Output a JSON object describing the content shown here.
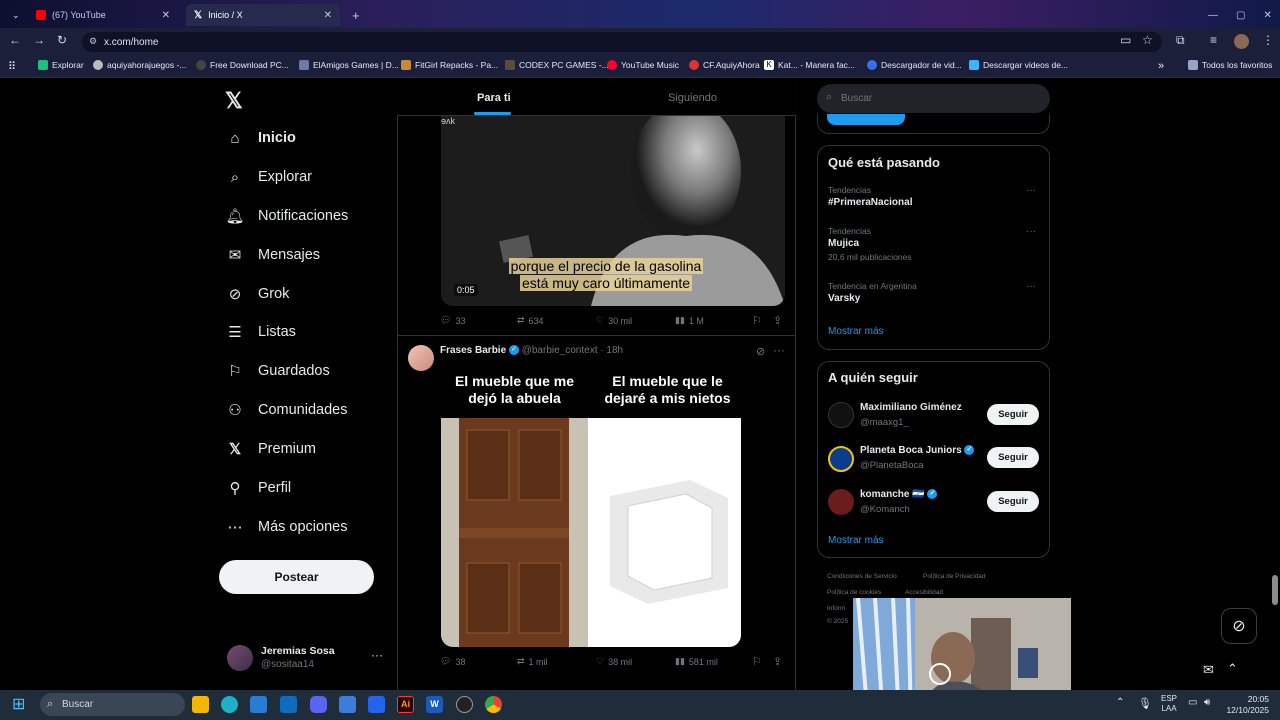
{
  "browser": {
    "tabs": [
      {
        "title": "(67) YouTube",
        "active": false,
        "color": "#ff0000"
      },
      {
        "title": "Inicio / X",
        "active": true,
        "color": "#ffffff"
      }
    ],
    "url": "x.com/home",
    "bookmarks": [
      "Explorar",
      "aquiyahorajuegos -...",
      "Free Download PC...",
      "ElAmigos Games | D...",
      "FitGirl Repacks - Pa...",
      "CODEX PC GAMES -...",
      "YouTube Music",
      "CF.AquiyAhora",
      "Kat... - Manera fac...",
      "Descargador de vid...",
      "Descargar videos de..."
    ],
    "all_bookmarks": "Todos los favoritos"
  },
  "nav": {
    "items": [
      "Inicio",
      "Explorar",
      "Notificaciones",
      "Mensajes",
      "Grok",
      "Listas",
      "Guardados",
      "Comunidades",
      "Premium",
      "Perfil",
      "Más opciones"
    ],
    "post_button": "Postear",
    "account_name": "Jeremias Sosa",
    "account_handle": "@sositaa14"
  },
  "feed": {
    "tabs": [
      "Para ti",
      "Siguiendo"
    ],
    "tweet1": {
      "subtitle_line1": "porque el precio de la gasolina",
      "subtitle_line2": "está muy caro últimamente",
      "duration": "0:05",
      "replies": "33",
      "reposts": "634",
      "likes": "30 mil",
      "views": "1 M"
    },
    "tweet2": {
      "name": "Frases Barbie",
      "handle": "@barbie_context",
      "time": "18h",
      "meme_left": "El mueble que me dejó la abuela",
      "meme_right": "El mueble que le dejaré a mis nietos",
      "replies": "38",
      "reposts": "1 mil",
      "likes": "38 mil",
      "views": "581 mil"
    }
  },
  "right": {
    "search_placeholder": "Buscar",
    "trends_title": "Qué está pasando",
    "trends": [
      {
        "context": "Tendencias",
        "name": "#PrimeraNacional",
        "count": ""
      },
      {
        "context": "Tendencias",
        "name": "Mujica",
        "count": "20,6 mil publicaciones"
      },
      {
        "context": "Tendencia en Argentina",
        "name": "Varsky",
        "count": ""
      }
    ],
    "show_more": "Mostrar más",
    "follow_title": "A quién seguir",
    "follow": [
      {
        "name": "Maximiliano Giménez",
        "handle": "@maaxg1_",
        "verified": false
      },
      {
        "name": "Planeta Boca Juniors",
        "handle": "@PlanetaBoca",
        "verified": true
      },
      {
        "name": "komanche 🇸🇻",
        "handle": "@Komanch",
        "verified": true
      }
    ],
    "follow_button": "Seguir",
    "footer": [
      "Condiciones de Servicio",
      "Política de Privacidad",
      "Política de cookies",
      "Accesibilidad",
      "Inform",
      "© 2025"
    ]
  },
  "taskbar": {
    "search": "Buscar",
    "lang1": "ESP",
    "lang2": "LAA",
    "time": "20:05",
    "date": "12/10/2025"
  }
}
